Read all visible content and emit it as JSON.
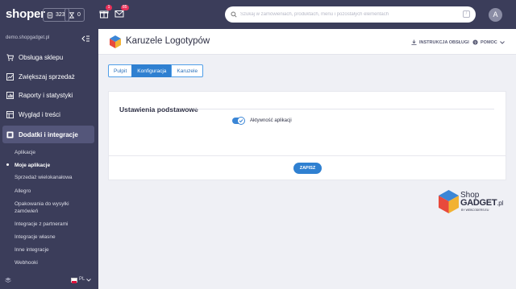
{
  "topbar": {
    "logo": "shoper",
    "orders_count": "323",
    "cart_count": "0",
    "notifications_badge": "1",
    "messages_badge": "85",
    "search_placeholder": "Szukaj w zamówieniach, produktach, menu i pozostałych elementach",
    "search_shortcut": "/",
    "avatar_initial": "A"
  },
  "sidebar": {
    "shop_url": "demo.shopgadget.pl",
    "items": [
      {
        "label": "Obsługa sklepu",
        "icon": "cart-icon"
      },
      {
        "label": "Zwiększaj sprzedaż",
        "icon": "chart-icon"
      },
      {
        "label": "Raporty i statystyki",
        "icon": "report-icon"
      },
      {
        "label": "Wygląd i treści",
        "icon": "layout-icon"
      },
      {
        "label": "Dodatki i integracje",
        "icon": "puzzle-icon"
      }
    ],
    "subitems": [
      "Aplikacje",
      "Moje aplikacje",
      "Sprzedaż wielokanałowa",
      "Allegro",
      "Opakowania do wysyłki zamówień",
      "Integracje z partnerami",
      "Integracje własne",
      "Inne integracje",
      "Webhooki"
    ],
    "language": "PL"
  },
  "header": {
    "title": "Karuzele Logotypów",
    "instructions": "INSTRUKCJA OBSŁUGI",
    "help": "POMOC"
  },
  "tabs": [
    {
      "label": "Pulpit",
      "active": false
    },
    {
      "label": "Konfiguracja",
      "active": true
    },
    {
      "label": "Karuzele",
      "active": false
    }
  ],
  "settings": {
    "section_title": "Ustawienia podstawowe",
    "toggle_label": "Aktywność aplikacji",
    "toggle_on": true,
    "save_label": "ZAPISZ"
  },
  "brand": {
    "line1": "Shop",
    "line2": "GADGET",
    "suffix": ".pl",
    "sub": "BY WEBCODERS.EU"
  }
}
